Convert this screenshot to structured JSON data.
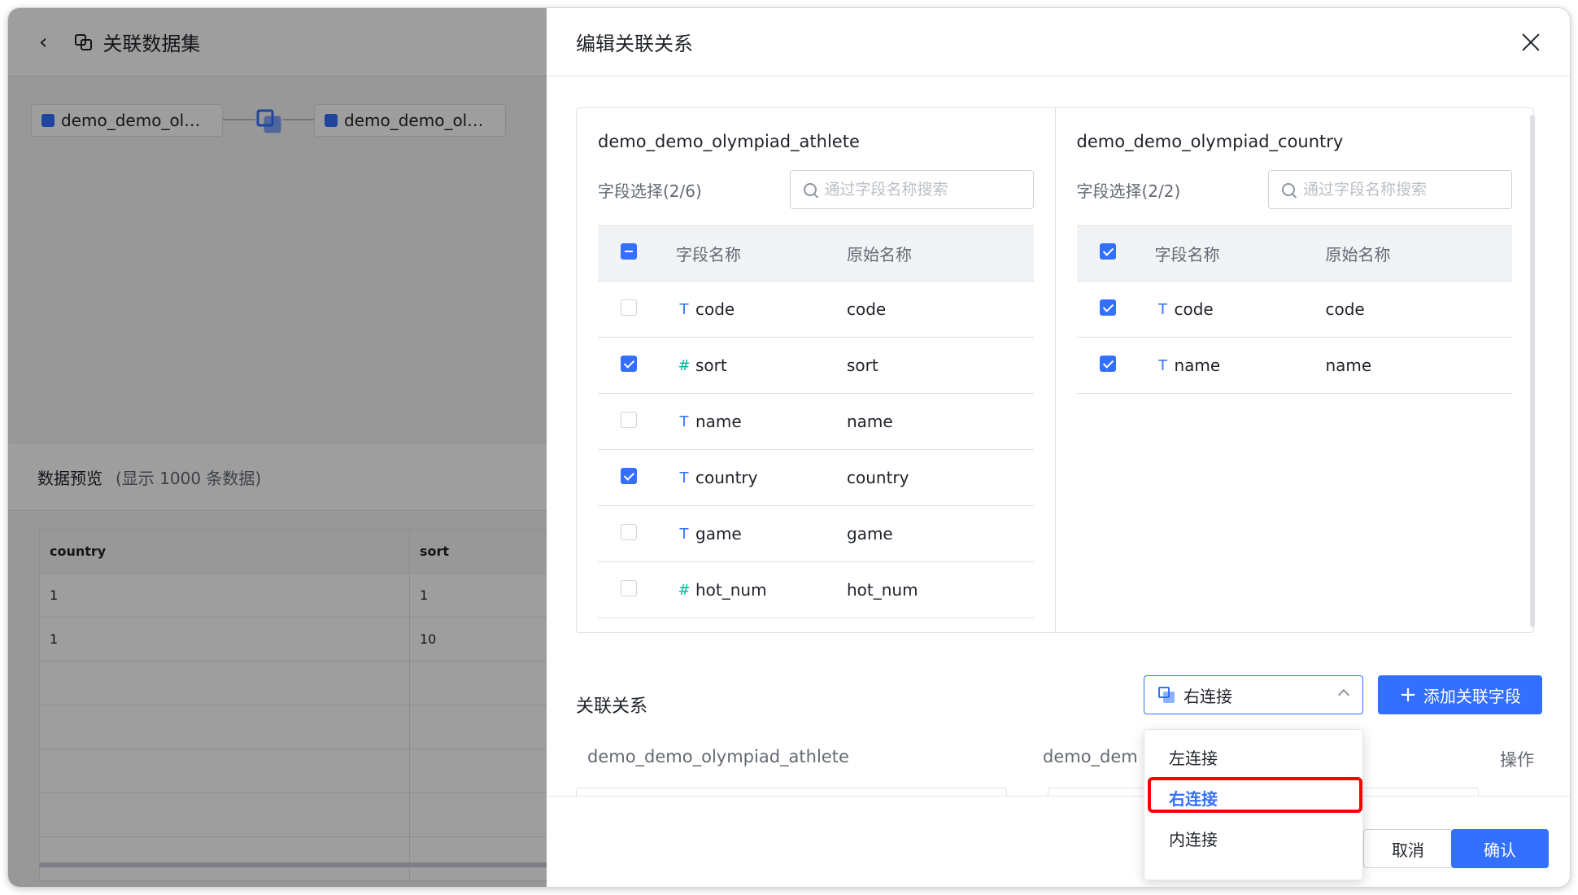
{
  "background": {
    "title": "关联数据集",
    "nodes": [
      "demo_demo_ol…",
      "demo_demo_ol…"
    ],
    "preview_title": "数据预览",
    "preview_sub": "(显示 1000 条数据)",
    "table": {
      "columns": [
        "country",
        "sort"
      ],
      "rows": [
        [
          "1",
          "1"
        ],
        [
          "1",
          "10"
        ],
        [
          "",
          ""
        ],
        [
          "",
          ""
        ],
        [
          "",
          ""
        ],
        [
          "",
          ""
        ],
        [
          "",
          ""
        ]
      ]
    }
  },
  "drawer": {
    "title": "编辑关联关系",
    "left": {
      "name": "demo_demo_olympiad_athlete",
      "select_label": "字段选择(2/6)",
      "search_placeholder": "通过字段名称搜索",
      "col_field": "字段名称",
      "col_origin": "原始名称",
      "rows": [
        {
          "type": "T",
          "field": "code",
          "origin": "code",
          "checked": false
        },
        {
          "type": "#",
          "field": "sort",
          "origin": "sort",
          "checked": true
        },
        {
          "type": "T",
          "field": "name",
          "origin": "name",
          "checked": false
        },
        {
          "type": "T",
          "field": "country",
          "origin": "country",
          "checked": true
        },
        {
          "type": "T",
          "field": "game",
          "origin": "game",
          "checked": false
        },
        {
          "type": "#",
          "field": "hot_num",
          "origin": "hot_num",
          "checked": false
        }
      ]
    },
    "right": {
      "name": "demo_demo_olympiad_country",
      "select_label": "字段选择(2/2)",
      "search_placeholder": "通过字段名称搜索",
      "col_field": "字段名称",
      "col_origin": "原始名称",
      "rows": [
        {
          "type": "T",
          "field": "code",
          "origin": "code",
          "checked": true
        },
        {
          "type": "T",
          "field": "name",
          "origin": "name",
          "checked": true
        }
      ]
    },
    "relation": {
      "title": "关联关系",
      "join_value": "右连接",
      "add_label": "添加关联字段",
      "left_col": "demo_demo_olympiad_athlete",
      "right_col": "demo_dem",
      "op_col": "操作"
    },
    "dropdown": [
      "左连接",
      "右连接",
      "内连接"
    ],
    "cancel": "取消",
    "ok": "确认"
  },
  "colors": {
    "accent": "#3370ff",
    "highlight": "#ff0000"
  }
}
